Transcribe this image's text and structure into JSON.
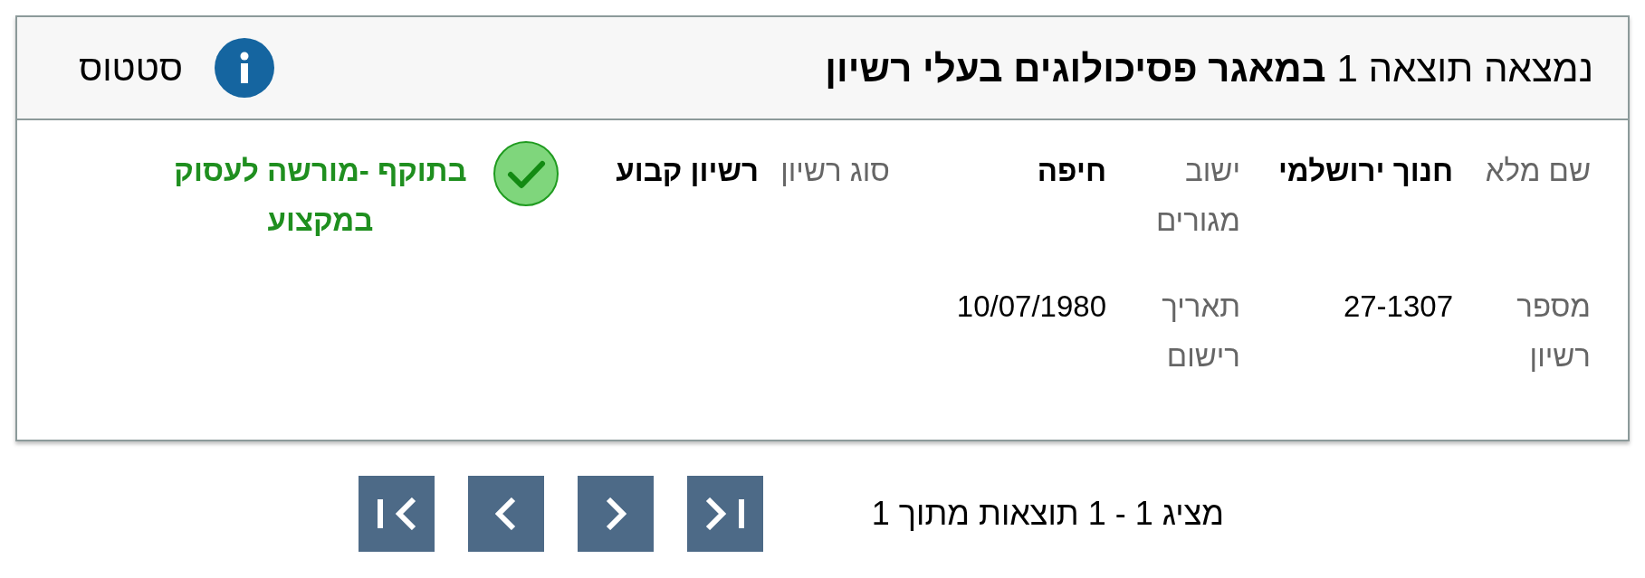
{
  "header": {
    "title": "נמצאה תוצאה 1 **במאגר פסיכולוגים בעלי רשיון**",
    "status_label": "סטטוס"
  },
  "rows": [
    {
      "fields": [
        {
          "label": "שם מלא",
          "value": "חנוך ירושלמי",
          "bold": true
        },
        {
          "label": "ישוב מגורים",
          "value": "חיפה",
          "bold": true
        },
        {
          "label": "סוג רשיון",
          "value": "רשיון קבוע",
          "bold": true
        }
      ],
      "status": {
        "text": "בתוקף -מורשה לעסוק במקצוע",
        "valid": true
      }
    },
    {
      "fields": [
        {
          "label": "מספר רשיון",
          "value": "27-1307",
          "bold": false
        },
        {
          "label": "תאריך רישום",
          "value": "10/07/1980",
          "bold": false
        }
      ]
    }
  ],
  "pagination": {
    "summary": "מציג 1 - 1 תוצאות מתוך 1",
    "buttons": [
      {
        "kind": "first"
      },
      {
        "kind": "prev"
      },
      {
        "kind": "next"
      },
      {
        "kind": "last"
      }
    ]
  }
}
